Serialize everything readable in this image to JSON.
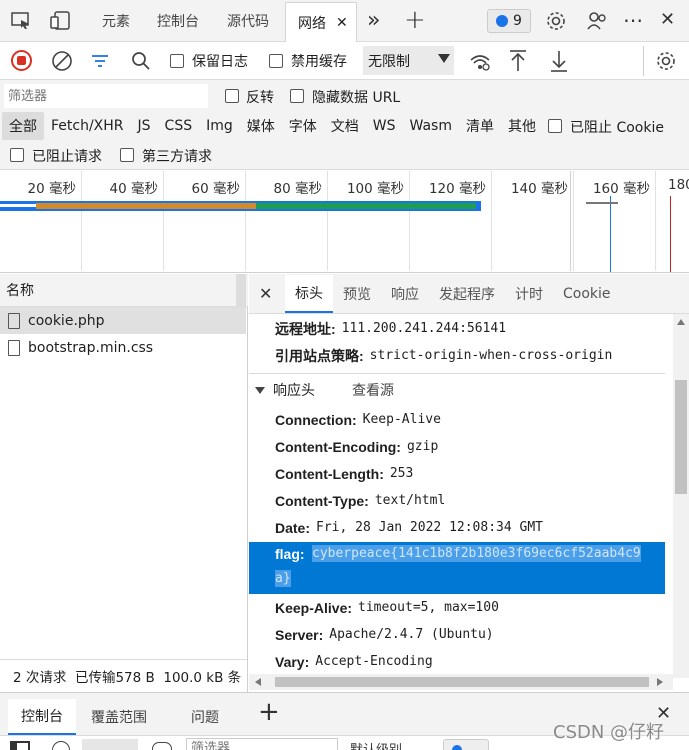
{
  "topbar": {
    "tabs": [
      "元素",
      "控制台",
      "源代码",
      "网络"
    ],
    "active_tab": "网络",
    "issues_count": "9"
  },
  "toolbar": {
    "preserve_log": "保留日志",
    "disable_cache": "禁用缓存",
    "throttle": "无限制"
  },
  "filterbar": {
    "placeholder": "筛选器",
    "invert": "反转",
    "hide_data_urls": "隐藏数据 URL",
    "types": [
      "全部",
      "Fetch/XHR",
      "JS",
      "CSS",
      "Img",
      "媒体",
      "字体",
      "文档",
      "WS",
      "Wasm",
      "清单",
      "其他"
    ],
    "blocked_cookies": "已阻止 Cookie",
    "blocked_requests": "已阻止请求",
    "third_party": "第三方请求"
  },
  "timeline": {
    "ticks": [
      "20 毫秒",
      "40 毫秒",
      "60 毫秒",
      "80 毫秒",
      "100 毫秒",
      "120 毫秒",
      "140 毫秒",
      "160 毫秒",
      "180"
    ]
  },
  "requests": {
    "column_name": "名称",
    "items": [
      "cookie.php",
      "bootstrap.min.css"
    ],
    "status": "2 次请求  已传输578 B  100.0 kB 条"
  },
  "details": {
    "tabs": [
      "标头",
      "预览",
      "响应",
      "发起程序",
      "计时",
      "Cookie"
    ],
    "general": [
      {
        "key": "远程地址:",
        "value": "111.200.241.244:56141"
      },
      {
        "key": "引用站点策略:",
        "value": "strict-origin-when-cross-origin"
      }
    ],
    "response_section": "响应头",
    "view_source": "查看源",
    "headers": [
      {
        "key": "Connection:",
        "value": "Keep-Alive"
      },
      {
        "key": "Content-Encoding:",
        "value": "gzip"
      },
      {
        "key": "Content-Length:",
        "value": "253"
      },
      {
        "key": "Content-Type:",
        "value": "text/html"
      },
      {
        "key": "Date:",
        "value": "Fri, 28 Jan 2022 12:08:34 GMT"
      }
    ],
    "flag": {
      "key": "flag:",
      "value1": "cyberpeace{141c1b8f2b180e3f69ec6cf52aab4c9",
      "value2": "a}"
    },
    "headers2": [
      {
        "key": "Keep-Alive:",
        "value": "timeout=5, max=100"
      },
      {
        "key": "Server:",
        "value": "Apache/2.4.7 (Ubuntu)"
      },
      {
        "key": "Vary:",
        "value": "Accept-Encoding"
      }
    ]
  },
  "drawer": {
    "tabs": [
      "控制台",
      "覆盖范围",
      "问题"
    ],
    "filter_placeholder": "筛选器",
    "level": "默认级别"
  },
  "watermark": "CSDN @仔籽",
  "colors": {
    "selection": "#0078d4",
    "accent": "#1a73e8",
    "record": "#d93025"
  }
}
